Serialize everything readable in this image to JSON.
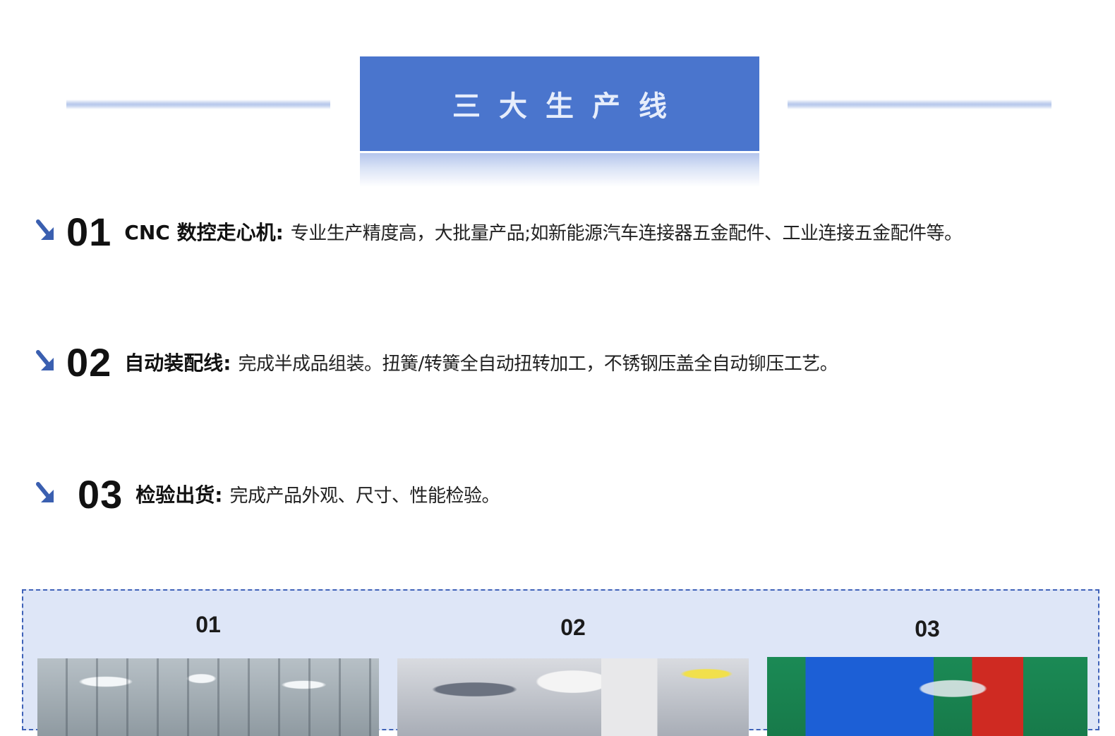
{
  "header": {
    "title": "三大生产线"
  },
  "production_lines": [
    {
      "number": "01",
      "label": "CNC 数控走心机:",
      "description": "专业生产精度高，大批量产品;如新能源汽车连接器五金配件、工业连接五金配件等。"
    },
    {
      "number": "02",
      "label": "自动装配线:",
      "description": "完成半成品组装。扭簧/转簧全自动扭转加工，不锈钢压盖全自动铆压工艺。"
    },
    {
      "number": "03",
      "label": "检验出货:",
      "description": "完成产品外观、尺寸、性能检验。"
    }
  ],
  "gallery": {
    "items": [
      {
        "label": "01"
      },
      {
        "label": "02"
      },
      {
        "label": "03"
      }
    ]
  },
  "colors": {
    "accent": "#4a75cd",
    "arrow": "#3a5fb0",
    "gallery_border": "#3f62b8",
    "gallery_background": "#dee6f7"
  },
  "icons": {
    "bullet": "arrow-down-right-icon"
  }
}
